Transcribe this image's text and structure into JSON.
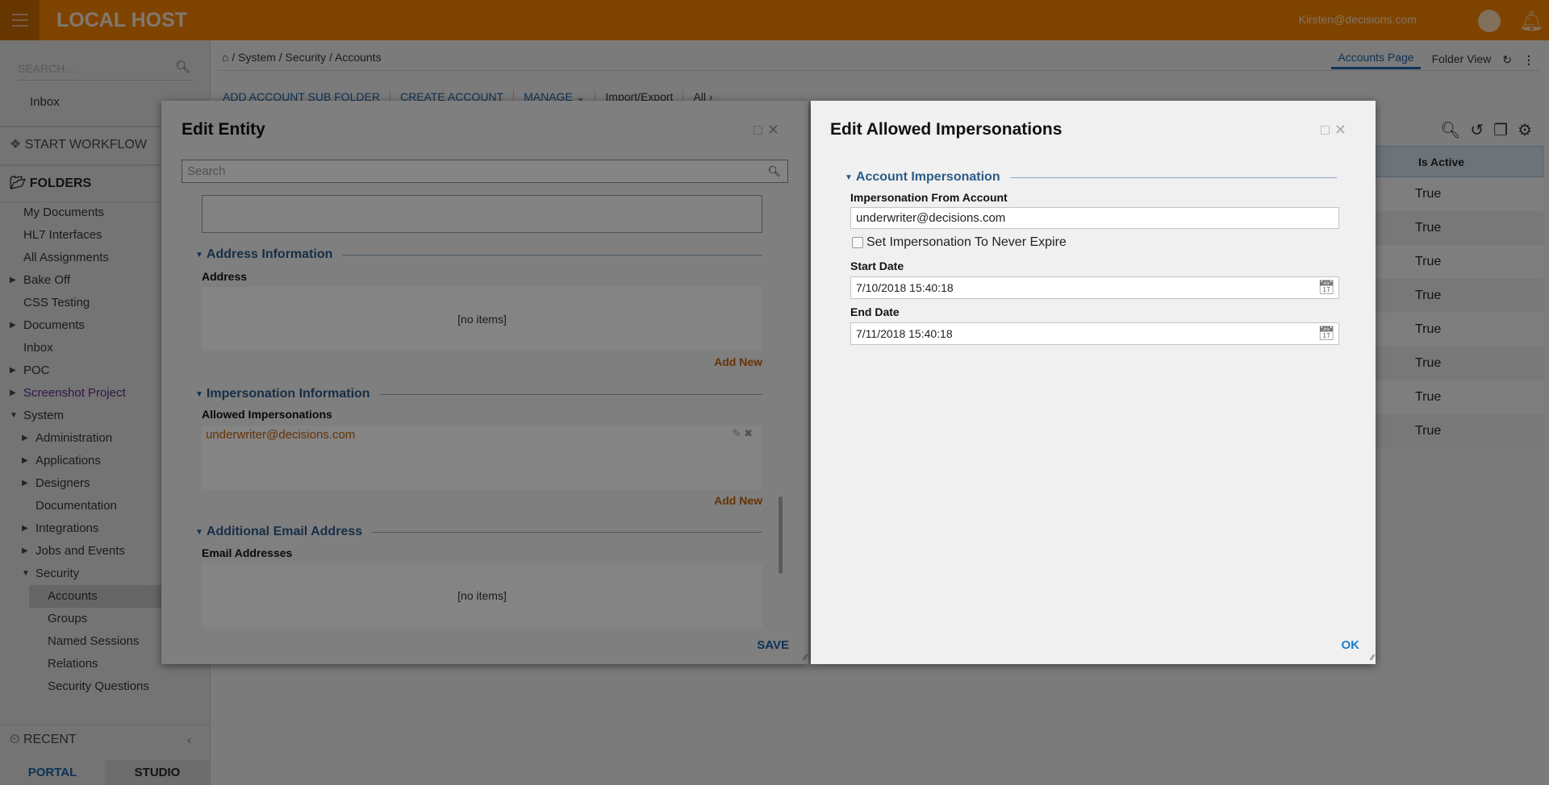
{
  "header": {
    "title": "LOCAL HOST",
    "user": "Kirsten@decisions.com",
    "colors": {
      "brand": "#f07f00",
      "link": "#1b5fa0",
      "accent_orange": "#c0620a"
    }
  },
  "sidebar": {
    "search_placeholder": "SEARCH...",
    "inbox": "Inbox",
    "start_workflow": "START WORKFLOW",
    "folders": "FOLDERS",
    "items": [
      {
        "label": "My Documents",
        "level": 0,
        "arrow": ""
      },
      {
        "label": "HL7 Interfaces",
        "level": 0,
        "arrow": ""
      },
      {
        "label": "All Assignments",
        "level": 0,
        "arrow": ""
      },
      {
        "label": "Bake Off",
        "level": 0,
        "arrow": "collapsed"
      },
      {
        "label": "CSS Testing",
        "level": 0,
        "arrow": ""
      },
      {
        "label": "Documents",
        "level": 0,
        "arrow": "collapsed"
      },
      {
        "label": "Inbox",
        "level": 0,
        "arrow": ""
      },
      {
        "label": "POC",
        "level": 0,
        "arrow": "collapsed"
      },
      {
        "label": "Screenshot Project",
        "level": 0,
        "arrow": "collapsed"
      },
      {
        "label": "System",
        "level": 0,
        "arrow": "expanded"
      },
      {
        "label": "Administration",
        "level": 1,
        "arrow": "collapsed"
      },
      {
        "label": "Applications",
        "level": 1,
        "arrow": "collapsed"
      },
      {
        "label": "Designers",
        "level": 1,
        "arrow": "collapsed"
      },
      {
        "label": "Documentation",
        "level": 1,
        "arrow": ""
      },
      {
        "label": "Integrations",
        "level": 1,
        "arrow": "collapsed"
      },
      {
        "label": "Jobs and Events",
        "level": 1,
        "arrow": "collapsed"
      },
      {
        "label": "Security",
        "level": 1,
        "arrow": "expanded"
      },
      {
        "label": "Accounts",
        "level": 2,
        "arrow": "",
        "selected": true
      },
      {
        "label": "Groups",
        "level": 2,
        "arrow": ""
      },
      {
        "label": "Named Sessions",
        "level": 2,
        "arrow": ""
      },
      {
        "label": "Relations",
        "level": 2,
        "arrow": ""
      },
      {
        "label": "Security Questions",
        "level": 2,
        "arrow": ""
      }
    ],
    "recent": "RECENT",
    "portal": "PORTAL",
    "studio": "STUDIO"
  },
  "breadcrumb": [
    "System",
    "Security",
    "Accounts"
  ],
  "toolbar": [
    "ADD ACCOUNT SUB FOLDER",
    "CREATE ACCOUNT",
    "MANAGE",
    "Import/Export",
    "All"
  ],
  "view_tabs": {
    "accounts_page": "Accounts Page",
    "folder_view": "Folder View"
  },
  "table": {
    "column": "Is Active",
    "rows": [
      "True",
      "True",
      "True",
      "True",
      "True",
      "True",
      "True",
      "True"
    ]
  },
  "edit_entity": {
    "title": "Edit Entity",
    "search_placeholder": "Search",
    "address_section": "Address Information",
    "address_label": "Address",
    "no_items": "[no items]",
    "add_new": "Add New",
    "impersonation_section": "Impersonation Information",
    "allowed_label": "Allowed Impersonations",
    "allowed_item": "underwriter@decisions.com",
    "email_section": "Additional Email Address",
    "email_label": "Email Addresses",
    "save": "SAVE"
  },
  "edit_impersonations": {
    "title": "Edit Allowed Impersonations",
    "section": "Account Impersonation",
    "from_label": "Impersonation From Account",
    "from_value": "underwriter@decisions.com",
    "never_expire_label": "Set Impersonation To Never Expire",
    "never_expire_checked": false,
    "start_label": "Start Date",
    "start_value": "7/10/2018 15:40:18",
    "end_label": "End Date",
    "end_value": "7/11/2018 15:40:18",
    "ok": "OK"
  }
}
